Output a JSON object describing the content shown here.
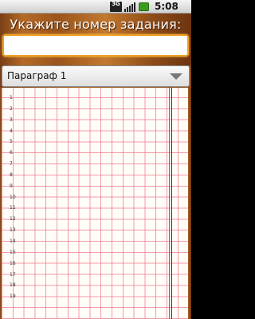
{
  "status_bar": {
    "network": "3G",
    "time": "5:08 pm"
  },
  "header": {
    "prompt": "Укажите номер задания:",
    "task_input": {
      "value": "",
      "placeholder": ""
    }
  },
  "paragraph_select": {
    "selected": "Параграф 1"
  },
  "grid": {
    "line_numbers": [
      "1",
      "2",
      "3",
      "4",
      "5",
      "6",
      "7",
      "8",
      "9",
      "10",
      "11",
      "12",
      "13",
      "14",
      "15",
      "16",
      "17",
      "18",
      "19"
    ]
  },
  "colors": {
    "accent_focus": "#f0a020",
    "grid_line": "#f0788c",
    "wood": "#9b541c"
  }
}
